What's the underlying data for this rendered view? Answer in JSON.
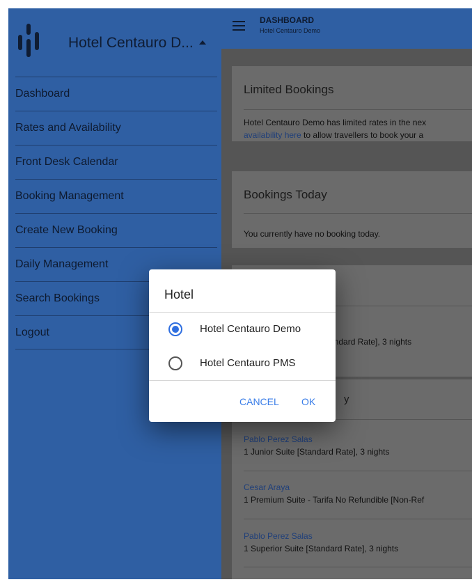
{
  "sidebar": {
    "hotel_name": "Hotel Centauro D...",
    "items": [
      {
        "label": "Dashboard"
      },
      {
        "label": "Rates and Availability"
      },
      {
        "label": "Front Desk Calendar"
      },
      {
        "label": "Booking Management"
      },
      {
        "label": "Create New Booking"
      },
      {
        "label": "Daily Management"
      },
      {
        "label": "Search Bookings"
      },
      {
        "label": "Logout"
      }
    ]
  },
  "appbar": {
    "title": "DASHBOARD",
    "subtitle": "Hotel Centauro Demo"
  },
  "cards": {
    "limited": {
      "title": "Limited Bookings",
      "text_line1": "Hotel Centauro Demo has limited rates in the nex",
      "link": "availability here",
      "text_line2_rest": " to allow travellers to book your a"
    },
    "today": {
      "title": "Bookings Today",
      "text": "You currently have no booking today."
    },
    "third": {
      "detail": "andard Rate], 3 nights"
    },
    "fourth": {
      "title_fragment": "y",
      "entries": [
        {
          "name": "Pablo Perez Salas",
          "detail": "1 Junior Suite [Standard Rate], 3 nights"
        },
        {
          "name": "Cesar Araya",
          "detail": "1 Premium Suite - Tarifa No Refundible [Non-Ref"
        },
        {
          "name": "Pablo Perez Salas",
          "detail": "1 Superior Suite [Standard Rate], 3 nights"
        }
      ]
    }
  },
  "dialog": {
    "title": "Hotel",
    "options": [
      {
        "label": "Hotel Centauro Demo",
        "checked": true
      },
      {
        "label": "Hotel Centauro PMS",
        "checked": false
      }
    ],
    "cancel_label": "CANCEL",
    "ok_label": "OK"
  },
  "colors": {
    "sidebar_bg": "#2f5fa3",
    "accent": "#2f6fe0",
    "button_text": "#3b7ee8"
  }
}
